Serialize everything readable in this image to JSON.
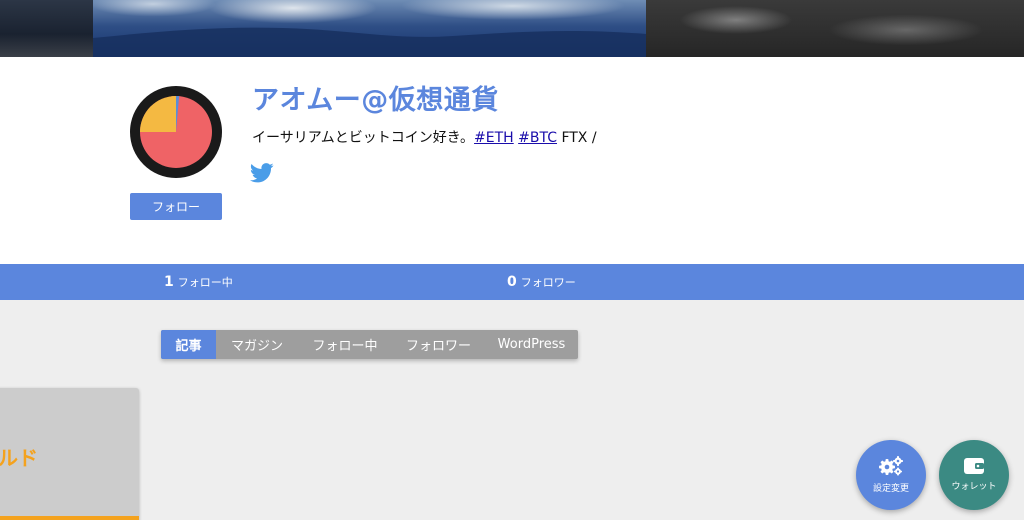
{
  "profile": {
    "name": "アオムー@仮想通貨",
    "bio_text": "イーサリアムとビットコイン好き。",
    "bio_tags": [
      "#ETH",
      "#BTC"
    ],
    "bio_suffix": " FTX /",
    "follow_label": "フォロー",
    "social_icon": "twitter-icon",
    "avatar_colors": {
      "ring": "#1a1a1a",
      "primary": "#ef6366",
      "secondary": "#f4b942",
      "accent": "#5a8ed8"
    }
  },
  "stats": {
    "following_count": "1",
    "following_label": "フォロー中",
    "followers_count": "0",
    "followers_label": "フォロワー"
  },
  "tabs": [
    {
      "label": "記事",
      "active": true
    },
    {
      "label": "マガジン",
      "active": false
    },
    {
      "label": "フォロー中",
      "active": false
    },
    {
      "label": "フォロワー",
      "active": false
    },
    {
      "label": "WordPress",
      "active": false
    }
  ],
  "card": {
    "title_fragment": "ルド"
  },
  "fab": {
    "settings_label": "設定変更",
    "settings_icon": "gears-icon",
    "wallet_label": "ウォレット",
    "wallet_icon": "wallet-icon"
  },
  "colors": {
    "accent": "#5b86dd",
    "wallet": "#3b8a83",
    "card_accent": "#f4a21d",
    "link": "#1a0dab"
  }
}
